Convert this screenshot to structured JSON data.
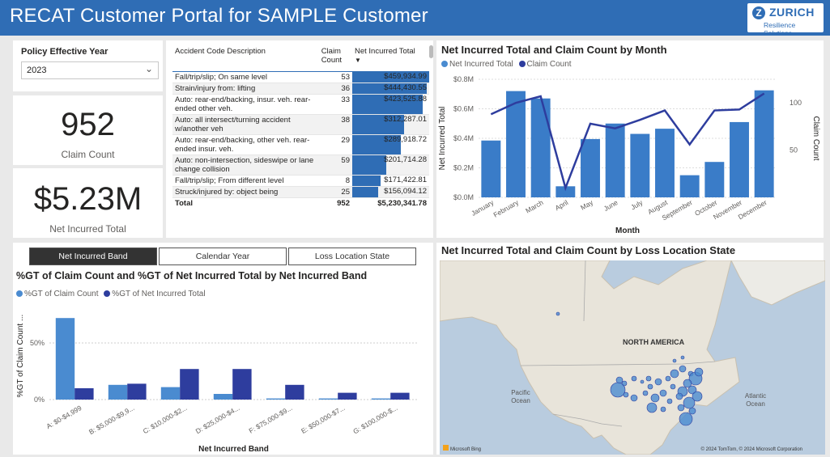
{
  "header": {
    "title": "RECAT Customer Portal for SAMPLE Customer",
    "logo_name": "ZURICH",
    "logo_sub": "Resilience Solutions"
  },
  "slicer": {
    "label": "Policy Effective Year",
    "value": "2023"
  },
  "kpi_count": {
    "value": "952",
    "label": "Claim Count"
  },
  "kpi_total": {
    "value": "$5.23M",
    "label": "Net Incurred Total"
  },
  "table": {
    "headers": [
      "Accident Code Description",
      "Claim Count",
      "Net Incurred Total"
    ],
    "rows": [
      {
        "desc": "Fall/trip/slip; On same level",
        "count": "53",
        "total": "$459,934.99",
        "pct": 100
      },
      {
        "desc": "Strain/injury from: lifting",
        "count": "36",
        "total": "$444,430.55",
        "pct": 96.6
      },
      {
        "desc": "Auto: rear-end/backing, insur. veh. rear-ended other veh.",
        "count": "33",
        "total": "$423,525.88",
        "pct": 92.1
      },
      {
        "desc": "Auto: all intersect/turning accident w/another veh",
        "count": "38",
        "total": "$312,287.01",
        "pct": 67.9
      },
      {
        "desc": "Auto: rear-end/backing, other veh. rear-ended insur. veh.",
        "count": "29",
        "total": "$289,918.72",
        "pct": 63.0
      },
      {
        "desc": "Auto: non-intersection, sideswipe or lane change collision",
        "count": "59",
        "total": "$201,714.28",
        "pct": 43.9
      },
      {
        "desc": "Fall/trip/slip; From different level",
        "count": "8",
        "total": "$171,422.81",
        "pct": 37.3
      },
      {
        "desc": "Struck/injured by: object being",
        "count": "25",
        "total": "$156,094.12",
        "pct": 33.9
      }
    ],
    "total": {
      "label": "Total",
      "count": "952",
      "total": "$5,230,341.78"
    }
  },
  "tabs": [
    "Net Incurred Band",
    "Calendar Year",
    "Loss Location State"
  ],
  "month_chart_title": "Net Incurred Total and Claim Count by Month",
  "month_legend": [
    "Net Incurred Total",
    "Claim Count"
  ],
  "band_chart_title": "%GT of Claim Count and %GT of Net Incurred Total by Net Incurred Band",
  "band_legend": [
    "%GT of Claim Count",
    "%GT of Net Incurred Total"
  ],
  "map_chart": {
    "title": "Net Incurred Total and Claim Count by Loss Location State",
    "labels": {
      "continent": "NORTH AMERICA",
      "pacific": "Pacific\nOcean",
      "atlantic": "Atlantic\nOcean"
    },
    "bing": "Microsoft Bing",
    "copyright": "© 2024 TomTom, © 2024 Microsoft Corporation"
  },
  "colors": {
    "header": "#2f6db5",
    "series_light": "#4a8bd0",
    "series_dark": "#2e3d9e",
    "bar": "#3a7cc8"
  },
  "chart_data": [
    {
      "type": "bar",
      "title": "Net Incurred Total and Claim Count by Month",
      "categories": [
        "January",
        "February",
        "March",
        "April",
        "May",
        "June",
        "July",
        "August",
        "September",
        "October",
        "November",
        "December"
      ],
      "series": [
        {
          "name": "Net Incurred Total",
          "type": "bar",
          "axis": "left",
          "values": [
            385000,
            720000,
            670000,
            75000,
            395000,
            500000,
            430000,
            465000,
            150000,
            240000,
            510000,
            725000
          ]
        },
        {
          "name": "Claim Count",
          "type": "line",
          "axis": "right",
          "values": [
            88,
            100,
            107,
            10,
            78,
            73,
            82,
            92,
            56,
            92,
            93,
            110
          ]
        }
      ],
      "xlabel": "Month",
      "ylabel": "Net Incurred Total",
      "y2label": "Claim Count",
      "yticks": [
        "$0.0M",
        "$0.2M",
        "$0.4M",
        "$0.6M",
        "$0.8M"
      ],
      "ylim": [
        0,
        800000
      ],
      "y2ticks": [
        "50",
        "100"
      ],
      "y2lim": [
        0,
        125
      ],
      "legend": "top-left"
    },
    {
      "type": "bar",
      "title": "%GT of Claim Count and %GT of Net Incurred Total by Net Incurred Band",
      "categories": [
        "A: $0-$4,999",
        "B: $5,000-$9,9...",
        "C: $10,000-$2...",
        "D: $25,000-$4...",
        "F: $75,000-$9...",
        "E: $50,000-$7...",
        "G: $100,000-$..."
      ],
      "series": [
        {
          "name": "%GT of Claim Count",
          "values": [
            72,
            13,
            11,
            5,
            1,
            1,
            1
          ]
        },
        {
          "name": "%GT of Net Incurred Total",
          "values": [
            10,
            14,
            27,
            27,
            13,
            6,
            6
          ]
        }
      ],
      "xlabel": "Net Incurred Band",
      "ylabel": "%GT of Claim Count ...",
      "yticks": [
        "0%",
        "50%"
      ],
      "ylim": [
        0,
        80
      ],
      "legend": "top-left"
    }
  ]
}
